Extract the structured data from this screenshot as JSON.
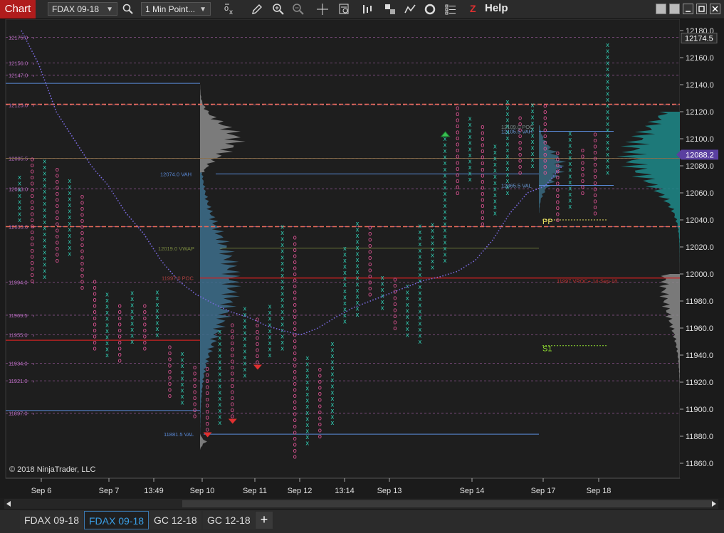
{
  "window": {
    "title": "Chart"
  },
  "toolbar": {
    "instrument": "FDAX 09-18",
    "interval": "1 Min Point...",
    "help_label": "Help",
    "help_icon": "Z"
  },
  "right_axis": {
    "labels": [
      "12180.0",
      "12160.0",
      "12140.0",
      "12120.0",
      "12100.0",
      "12080.0",
      "12060.0",
      "12040.0",
      "12020.0",
      "12000.0",
      "11980.0",
      "11960.0",
      "11940.0",
      "11920.0",
      "11900.0",
      "11880.0",
      "11860.0"
    ],
    "top_marker": "12174.5",
    "price_marker": "12088.2"
  },
  "left_levels": [
    "12175.0",
    "12156.0",
    "12147.0",
    "12125.0",
    "12085.5",
    "12063.0",
    "12035.0",
    "11994.0",
    "11969.5",
    "11955.0",
    "11934.0",
    "11921.0",
    "11897.0"
  ],
  "annotations": {
    "vah1": "12074.0 VAH",
    "vwap": "12019.0 VWAP",
    "poc": "11997.0 POC",
    "vpoc": "11997.0 VPOC",
    "val1": "11881.5 VAL",
    "poc2": "12109.0 POC",
    "vah2": "12105.5 VAH",
    "val2": "12065.5 VAL",
    "vpoc_label": "11997.0 VPOC",
    "vpoc_right": "11997 VPOC+ 14-Sep-18",
    "pp": "PP",
    "s1": "S1"
  },
  "time_labels": [
    "Sep 6",
    "Sep 7",
    "13:49",
    "Sep 10",
    "Sep 11",
    "Sep 12",
    "13:14",
    "Sep 13",
    "Sep 14",
    "Sep 17",
    "Sep 18"
  ],
  "copyright": "© 2018 NinjaTrader, LLC",
  "tabs": [
    "FDAX 09-18",
    "FDAX 09-18",
    "GC 12-18",
    "GC 12-18"
  ],
  "active_tab": 1,
  "add_tab": "+",
  "colors": {
    "x_color": "#2fc9b0",
    "o_color": "#e8559a",
    "vwap_dots": "#7a6ae0",
    "session_line": "#e86a5a",
    "level_line": "#a560a8",
    "val_line": "#5a8ad8",
    "poc_line": "#cc2222"
  },
  "chart_data": {
    "type": "point-and-figure",
    "instrument": "FDAX 09-18",
    "interval": "1 Min Point...",
    "ylim": [
      11855,
      12185
    ],
    "last_price": 12088.2,
    "high_marker": 12174.5,
    "columns": [
      {
        "t": "Sep 6",
        "low": 12040,
        "high": 12072,
        "dir": "X"
      },
      {
        "t": "Sep 6",
        "low": 11995,
        "high": 12085,
        "dir": "O"
      },
      {
        "t": "Sep 6",
        "low": 11998,
        "high": 12085,
        "dir": "X"
      },
      {
        "t": "Sep 6",
        "low": 12010,
        "high": 12080,
        "dir": "O"
      },
      {
        "t": "Sep 6",
        "low": 12015,
        "high": 12070,
        "dir": "X"
      },
      {
        "t": "Sep 6",
        "low": 11990,
        "high": 12060,
        "dir": "O"
      },
      {
        "t": "Sep 7",
        "low": 11945,
        "high": 11995,
        "dir": "O"
      },
      {
        "t": "Sep 7",
        "low": 11940,
        "high": 11985,
        "dir": "X"
      },
      {
        "t": "Sep 7",
        "low": 11936,
        "high": 11978,
        "dir": "O"
      },
      {
        "t": "Sep 7",
        "low": 11950,
        "high": 11990,
        "dir": "X"
      },
      {
        "t": "Sep 7",
        "low": 11945,
        "high": 11980,
        "dir": "O"
      },
      {
        "t": "Sep 7",
        "low": 11955,
        "high": 11988,
        "dir": "X"
      },
      {
        "t": "13:49",
        "low": 11910,
        "high": 11950,
        "dir": "O"
      },
      {
        "t": "13:49",
        "low": 11905,
        "high": 11945,
        "dir": "X"
      },
      {
        "t": "13:49",
        "low": 11895,
        "high": 11935,
        "dir": "O"
      },
      {
        "t": "13:49",
        "low": 11885,
        "high": 11930,
        "dir": "O"
      },
      {
        "t": "13:49",
        "low": 11890,
        "high": 11958,
        "dir": "X"
      },
      {
        "t": "Sep 10",
        "low": 11895,
        "high": 11965,
        "dir": "O"
      },
      {
        "t": "Sep 10",
        "low": 11925,
        "high": 11975,
        "dir": "X"
      },
      {
        "t": "Sep 10",
        "low": 11935,
        "high": 11970,
        "dir": "O"
      },
      {
        "t": "Sep 10",
        "low": 11940,
        "high": 11980,
        "dir": "X"
      },
      {
        "t": "Sep 11",
        "low": 11945,
        "high": 12035,
        "dir": "X"
      },
      {
        "t": "Sep 11",
        "low": 11865,
        "high": 12030,
        "dir": "O"
      },
      {
        "t": "Sep 11",
        "low": 11875,
        "high": 11940,
        "dir": "X"
      },
      {
        "t": "Sep 11",
        "low": 11880,
        "high": 11930,
        "dir": "O"
      },
      {
        "t": "Sep 11",
        "low": 11890,
        "high": 11950,
        "dir": "X"
      },
      {
        "t": "Sep 12",
        "low": 11965,
        "high": 12020,
        "dir": "X"
      },
      {
        "t": "Sep 12",
        "low": 11970,
        "high": 12038,
        "dir": "X"
      },
      {
        "t": "Sep 12",
        "low": 11985,
        "high": 12035,
        "dir": "O"
      },
      {
        "t": "Sep 12",
        "low": 11975,
        "high": 12000,
        "dir": "X"
      },
      {
        "t": "13:14",
        "low": 11960,
        "high": 11998,
        "dir": "O"
      },
      {
        "t": "13:14",
        "low": 11955,
        "high": 11995,
        "dir": "X"
      },
      {
        "t": "13:14",
        "low": 11950,
        "high": 12037,
        "dir": "X"
      },
      {
        "t": "Sep 13",
        "low": 12005,
        "high": 12040,
        "dir": "X"
      },
      {
        "t": "Sep 13",
        "low": 12010,
        "high": 12100,
        "dir": "X"
      },
      {
        "t": "Sep 13",
        "low": 12060,
        "high": 12125,
        "dir": "O"
      },
      {
        "t": "Sep 13",
        "low": 12070,
        "high": 12115,
        "dir": "X"
      },
      {
        "t": "Sep 14",
        "low": 12037,
        "high": 12110,
        "dir": "O"
      },
      {
        "t": "Sep 14",
        "low": 12045,
        "high": 12095,
        "dir": "X"
      },
      {
        "t": "Sep 14",
        "low": 12060,
        "high": 12128,
        "dir": "X"
      },
      {
        "t": "Sep 14",
        "low": 12075,
        "high": 12118,
        "dir": "O"
      },
      {
        "t": "Sep 14",
        "low": 12080,
        "high": 12128,
        "dir": "X"
      },
      {
        "t": "Sep 17",
        "low": 12075,
        "high": 12125,
        "dir": "O"
      },
      {
        "t": "Sep 17",
        "low": 12040,
        "high": 12090,
        "dir": "O"
      },
      {
        "t": "Sep 17",
        "low": 12050,
        "high": 12105,
        "dir": "X"
      },
      {
        "t": "Sep 18",
        "low": 12060,
        "high": 12095,
        "dir": "O"
      },
      {
        "t": "Sep 18",
        "low": 12045,
        "high": 12105,
        "dir": "O"
      },
      {
        "t": "Sep 18",
        "low": 12075,
        "high": 12170,
        "dir": "X"
      }
    ],
    "vwap": [
      12180,
      12155,
      12120,
      12100,
      12080,
      12065,
      12045,
      12030,
      12010,
      11995,
      11985,
      11978,
      11972,
      11968,
      11962,
      11958,
      11955,
      11960,
      11968,
      11975,
      11980,
      11985,
      11990,
      11995,
      11998,
      12002,
      12010,
      12025,
      12045,
      12060,
      12065,
      12080
    ],
    "levels": {
      "session_dashed": [
        12125.5,
        12035
      ],
      "blue_lines": [
        12141,
        12074,
        11881.5,
        12105.5,
        12065.5,
        11899
      ],
      "red_lines": [
        11997,
        11951,
        12085.5
      ],
      "pp": 12040,
      "s1": 11947
    }
  }
}
